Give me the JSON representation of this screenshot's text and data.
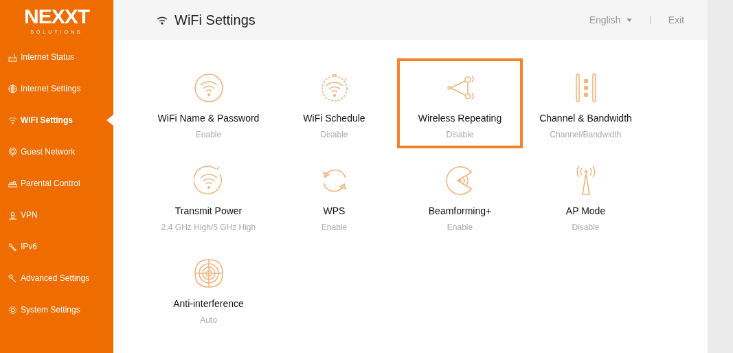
{
  "logo": {
    "brand": "NEXXT",
    "tagline": "SOLUTIONS"
  },
  "sidebar": {
    "items": [
      {
        "label": "Internet Status",
        "selected": false
      },
      {
        "label": "Internet Settings",
        "selected": false
      },
      {
        "label": "WiFi Settings",
        "selected": true
      },
      {
        "label": "Guest Network",
        "selected": false
      },
      {
        "label": "Parental Control",
        "selected": false
      },
      {
        "label": "VPN",
        "selected": false
      },
      {
        "label": "IPv6",
        "selected": false
      },
      {
        "label": "Advanced Settings",
        "selected": false
      },
      {
        "label": "System Settings",
        "selected": false
      }
    ]
  },
  "header": {
    "title": "WiFi Settings",
    "language": "English",
    "exit": "Exit"
  },
  "tiles": [
    {
      "title": "WiFi Name & Password",
      "status": "Enable",
      "selected": false
    },
    {
      "title": "WiFi Schedule",
      "status": "Disable",
      "selected": false
    },
    {
      "title": "Wireless Repeating",
      "status": "Disable",
      "selected": true
    },
    {
      "title": "Channel & Bandwidth",
      "status": "Channel/Bandwidth",
      "selected": false
    },
    {
      "title": "Transmit Power",
      "status": "2.4 GHz High/5 GHz High",
      "selected": false
    },
    {
      "title": "WPS",
      "status": "Enable",
      "selected": false
    },
    {
      "title": "Beamforming+",
      "status": "Enable",
      "selected": false
    },
    {
      "title": "AP Mode",
      "status": "Disable",
      "selected": false
    },
    {
      "title": "Anti-interference",
      "status": "Auto",
      "selected": false
    }
  ]
}
